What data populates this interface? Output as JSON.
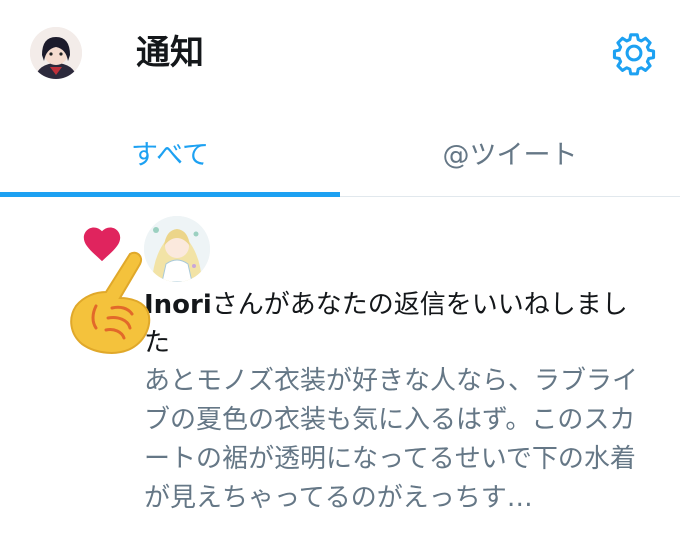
{
  "header": {
    "title": "通知",
    "avatar_icon": "user-avatar",
    "settings_icon": "gear-icon"
  },
  "tabs": [
    {
      "label": "すべて",
      "active": true
    },
    {
      "label": "@ツイート",
      "active": false
    }
  ],
  "notification": {
    "type_icon": "heart-icon",
    "user": "Inori",
    "action_text": "さんがあなたの返信をいいねしました",
    "tweet_preview": "あとモノズ衣装が好きな人なら、ラブライブの夏色の衣装も気に入るはず。このスカートの裾が透明になってるせいで下の水着が見えちゃってるのがえっちす…"
  },
  "overlay": {
    "icon": "pointing-hand-icon"
  },
  "colors": {
    "accent": "#1da1f2",
    "secondary_text": "#657786",
    "like": "#e0245e",
    "primary_text": "#14171a"
  }
}
